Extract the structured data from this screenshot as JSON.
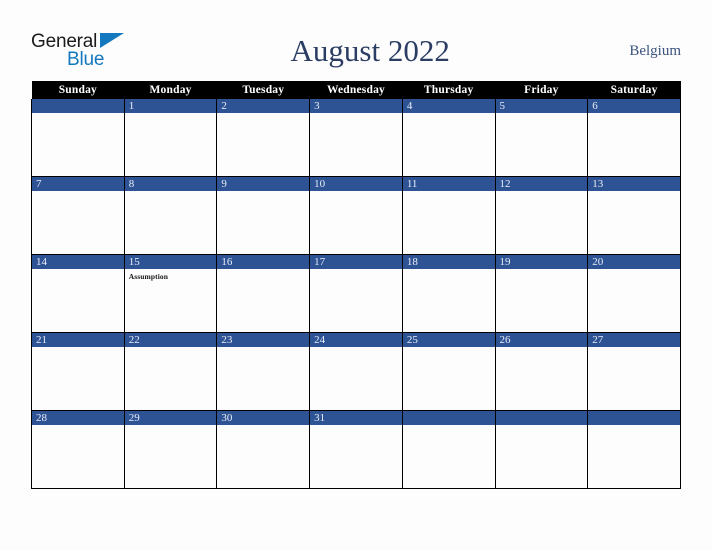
{
  "logo": {
    "word_one": "General",
    "word_two": "Blue",
    "triangle_icon": "triangle-icon",
    "color_dark": "#1b1b1b",
    "color_blue": "#1478be"
  },
  "header": {
    "title": "August 2022",
    "country": "Belgium",
    "title_color": "#2b3d63",
    "country_color": "#3b527f"
  },
  "calendar": {
    "accent_color": "#2e5395",
    "header_bg": "#000000",
    "header_fg": "#ffffff",
    "weekday_headers": [
      "Sunday",
      "Monday",
      "Tuesday",
      "Wednesday",
      "Thursday",
      "Friday",
      "Saturday"
    ],
    "weeks": [
      [
        {
          "date": "",
          "event": ""
        },
        {
          "date": "1",
          "event": ""
        },
        {
          "date": "2",
          "event": ""
        },
        {
          "date": "3",
          "event": ""
        },
        {
          "date": "4",
          "event": ""
        },
        {
          "date": "5",
          "event": ""
        },
        {
          "date": "6",
          "event": ""
        }
      ],
      [
        {
          "date": "7",
          "event": ""
        },
        {
          "date": "8",
          "event": ""
        },
        {
          "date": "9",
          "event": ""
        },
        {
          "date": "10",
          "event": ""
        },
        {
          "date": "11",
          "event": ""
        },
        {
          "date": "12",
          "event": ""
        },
        {
          "date": "13",
          "event": ""
        }
      ],
      [
        {
          "date": "14",
          "event": ""
        },
        {
          "date": "15",
          "event": "Assumption"
        },
        {
          "date": "16",
          "event": ""
        },
        {
          "date": "17",
          "event": ""
        },
        {
          "date": "18",
          "event": ""
        },
        {
          "date": "19",
          "event": ""
        },
        {
          "date": "20",
          "event": ""
        }
      ],
      [
        {
          "date": "21",
          "event": ""
        },
        {
          "date": "22",
          "event": ""
        },
        {
          "date": "23",
          "event": ""
        },
        {
          "date": "24",
          "event": ""
        },
        {
          "date": "25",
          "event": ""
        },
        {
          "date": "26",
          "event": ""
        },
        {
          "date": "27",
          "event": ""
        }
      ],
      [
        {
          "date": "28",
          "event": ""
        },
        {
          "date": "29",
          "event": ""
        },
        {
          "date": "30",
          "event": ""
        },
        {
          "date": "31",
          "event": ""
        },
        {
          "date": "",
          "event": ""
        },
        {
          "date": "",
          "event": ""
        },
        {
          "date": "",
          "event": ""
        }
      ]
    ]
  }
}
